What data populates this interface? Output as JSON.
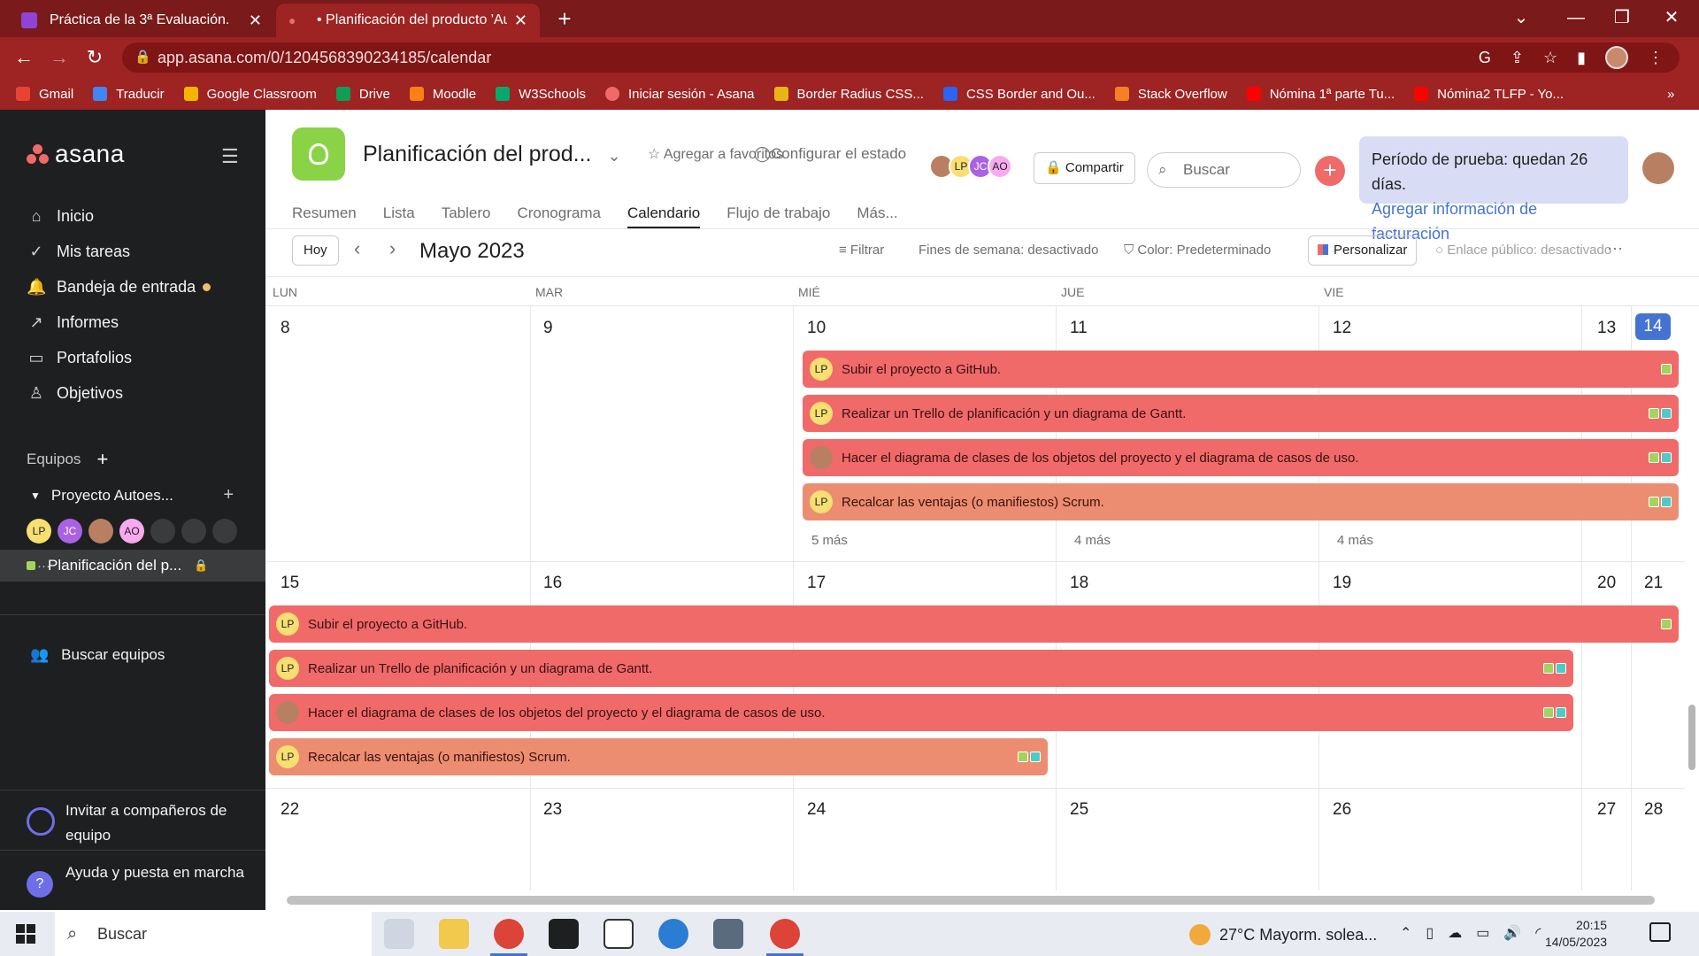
{
  "browser": {
    "tabs": [
      {
        "title": "Práctica de la 3ª Evaluación.",
        "close": "✕"
      },
      {
        "title": "• Planificación del producto 'Aut",
        "close": "✕"
      }
    ],
    "new_tab": "+",
    "url": "app.asana.com/0/1204568390234185/calendar",
    "bookmarks": [
      "Gmail",
      "Traducir",
      "Google Classroom",
      "Drive",
      "Moodle",
      "W3Schools",
      "Iniciar sesión - Asana",
      "Border Radius CSS...",
      "CSS Border and Ou...",
      "Stack Overflow",
      "Nómina 1ª parte Tu...",
      "Nómina2 TLFP - Yo..."
    ],
    "bookmark_more": "»"
  },
  "sidebar": {
    "logo": "asana",
    "nav": [
      {
        "label": "Inicio",
        "icon": "home-icon"
      },
      {
        "label": "Mis tareas",
        "icon": "check-circle-icon"
      },
      {
        "label": "Bandeja de entrada",
        "icon": "bell-icon"
      },
      {
        "label": "Informes",
        "icon": "chart-line-icon"
      },
      {
        "label": "Portafolios",
        "icon": "folder-icon"
      },
      {
        "label": "Objetivos",
        "icon": "person-icon"
      }
    ],
    "teams_label": "Equipos",
    "team_name": "Proyecto Autoes...",
    "members": [
      "LP",
      "JC",
      "",
      "AO"
    ],
    "project": "Planificación del p...",
    "find_teams": "Buscar equipos",
    "invite": "Invitar a compañeros de equipo",
    "help": "Ayuda y puesta en marcha"
  },
  "header": {
    "title": "Planificación del prod...",
    "favorite": "Agregar a favoritos",
    "status": "Configurar el estado",
    "members": [
      "",
      "LP",
      "JC",
      "AO"
    ],
    "share": "Compartir",
    "search_placeholder": "Buscar",
    "trial_line1": "Período de prueba: quedan 26 días.",
    "trial_line2": "Agregar información de facturación",
    "tabs": [
      "Resumen",
      "Lista",
      "Tablero",
      "Cronograma",
      "Calendario",
      "Flujo de trabajo",
      "Más..."
    ],
    "active_tab": "Calendario"
  },
  "toolbar": {
    "today": "Hoy",
    "month": "Mayo 2023",
    "filter": "Filtrar",
    "weekends": "Fines de semana: desactivado",
    "color": "Color: Predeterminado",
    "customize": "Personalizar",
    "public_link": "Enlace público: desactivado",
    "more": "···"
  },
  "calendar": {
    "day_headers": [
      "LUN",
      "MAR",
      "MIÉ",
      "JUE",
      "VIE"
    ],
    "weeks": [
      {
        "days": [
          "8",
          "9",
          "10",
          "11",
          "12",
          "13",
          "14"
        ],
        "today_index": 6,
        "more": [
          "5 más",
          "4 más",
          "4 más"
        ]
      },
      {
        "days": [
          "15",
          "16",
          "17",
          "18",
          "19",
          "20",
          "21"
        ]
      },
      {
        "days": [
          "22",
          "23",
          "24",
          "25",
          "26",
          "27",
          "28"
        ]
      }
    ],
    "events_week1": [
      {
        "title": "Subir el proyecto a GitHub.",
        "assignee": "LP",
        "tags": [
          "#a2d45e"
        ]
      },
      {
        "title": "Realizar un Trello de planificación y un diagrama de Gantt.",
        "assignee": "LP",
        "tags": [
          "#a2d45e",
          "#4ecbc4"
        ]
      },
      {
        "title": "Hacer el diagrama de clases de los objetos del proyecto y el diagrama de casos de uso.",
        "assignee": "",
        "tags": [
          "#a2d45e",
          "#4ecbc4"
        ]
      },
      {
        "title": "Recalcar las ventajas (o manifiestos) Scrum.",
        "assignee": "LP",
        "tags": [
          "#a2d45e",
          "#4ecbc4"
        ]
      }
    ],
    "events_week2": [
      {
        "title": "Subir el proyecto a GitHub.",
        "assignee": "LP",
        "tags": [
          "#a2d45e"
        ]
      },
      {
        "title": "Realizar un Trello de planificación y un diagrama de Gantt.",
        "assignee": "LP",
        "tags": [
          "#a2d45e",
          "#4ecbc4"
        ]
      },
      {
        "title": "Hacer el diagrama de clases de los objetos del proyecto y el diagrama de casos de uso.",
        "assignee": "",
        "tags": [
          "#a2d45e",
          "#4ecbc4"
        ]
      },
      {
        "title": "Recalcar las ventajas (o manifiestos) Scrum.",
        "assignee": "LP",
        "tags": [
          "#a2d45e",
          "#4ecbc4"
        ]
      }
    ]
  },
  "taskbar": {
    "search": "Buscar",
    "weather": "27°C  Mayorm. solea...",
    "time": "20:15",
    "date": "14/05/2023"
  },
  "colors": {
    "accent": "#f06a6a",
    "brand_blue": "#4573d2",
    "chrome": "#9e2323"
  }
}
